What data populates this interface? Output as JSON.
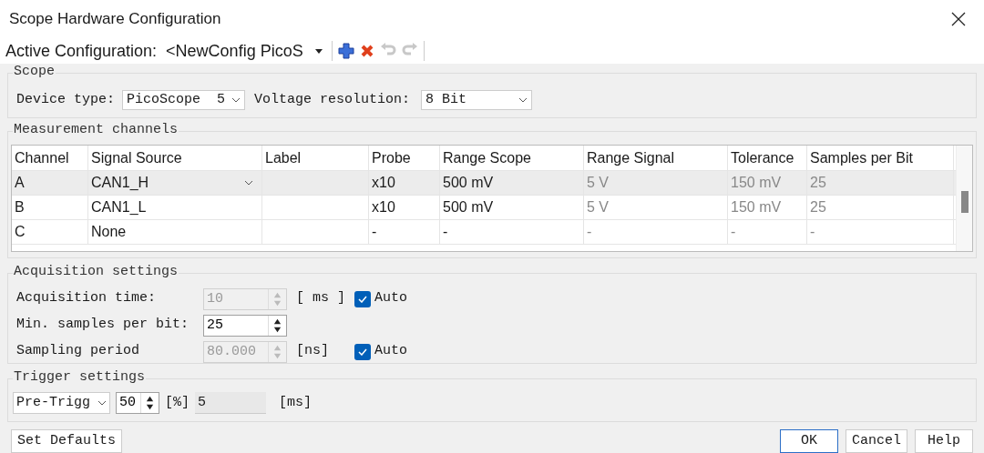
{
  "window": {
    "title": "Scope Hardware Configuration"
  },
  "active_configuration": {
    "label": "Active Configuration:",
    "value": "<NewConfig PicoS"
  },
  "toolbar": [
    {
      "kind": "add",
      "disabled": false
    },
    {
      "kind": "delete",
      "disabled": false
    },
    {
      "kind": "undo",
      "disabled": true
    },
    {
      "kind": "redo",
      "disabled": true
    }
  ],
  "scope": {
    "title": "Scope",
    "device_type": {
      "label": "Device type:",
      "value": "PicoScope  5"
    },
    "voltage_resolution": {
      "label": "Voltage resolution:",
      "value": "8 Bit"
    }
  },
  "measurement_channels": {
    "title": "Measurement channels",
    "columns": [
      "Channel",
      "Signal Source",
      "Label",
      "Probe",
      "Range Scope",
      "Range Signal",
      "Tolerance",
      "Samples per Bit"
    ],
    "rows": [
      {
        "selected": true,
        "editing": true,
        "cells": [
          {
            "text": "A",
            "dimmed": false
          },
          {
            "text": "CAN1_H",
            "dimmed": false
          },
          null,
          {
            "text": "x10",
            "dimmed": false
          },
          {
            "text": "500 mV",
            "dimmed": false
          },
          {
            "text": "5 V",
            "dimmed": true
          },
          {
            "text": "150 mV",
            "dimmed": true
          },
          {
            "text": "25",
            "dimmed": true
          }
        ]
      },
      {
        "selected": false,
        "editing": false,
        "cells": [
          {
            "text": "B",
            "dimmed": false
          },
          {
            "text": "CAN1_L",
            "dimmed": false
          },
          null,
          {
            "text": "x10",
            "dimmed": false
          },
          {
            "text": "500 mV",
            "dimmed": false
          },
          {
            "text": "5 V",
            "dimmed": true
          },
          {
            "text": "150 mV",
            "dimmed": true
          },
          {
            "text": "25",
            "dimmed": true
          }
        ]
      },
      {
        "selected": false,
        "editing": false,
        "cells": [
          {
            "text": "C",
            "dimmed": false
          },
          {
            "text": "None",
            "dimmed": false
          },
          null,
          {
            "text": "-",
            "dimmed": false
          },
          {
            "text": "-",
            "dimmed": false
          },
          {
            "text": "-",
            "dimmed": true
          },
          {
            "text": "-",
            "dimmed": true
          },
          {
            "text": "-",
            "dimmed": true
          }
        ]
      }
    ]
  },
  "acquisition": {
    "title": "Acquisition settings",
    "fields": [
      {
        "label": "Acquisition time:",
        "value": "10",
        "disabled": true,
        "unit": "[ ms ]",
        "auto": {
          "label": "Auto",
          "checked": true
        }
      },
      {
        "label": "Min. samples per bit:",
        "value": "25",
        "disabled": false
      },
      {
        "label": "Sampling period",
        "value": "80.000",
        "disabled": true,
        "unit": "[ns]",
        "auto": {
          "label": "Auto",
          "checked": true
        }
      }
    ]
  },
  "trigger": {
    "title": "Trigger settings",
    "mode": "Pre-Trigg",
    "percent": "50",
    "percent_unit": "[%]",
    "time": "5",
    "time_unit": "[ms]"
  },
  "buttons": [
    {
      "kind": "defaults",
      "label": "Set Defaults",
      "default": false
    },
    {
      "kind": "dialog",
      "label": "OK",
      "default": true
    },
    {
      "kind": "dialog",
      "label": "Cancel",
      "default": false
    },
    {
      "kind": "dialog",
      "label": "Help",
      "default": false
    }
  ]
}
